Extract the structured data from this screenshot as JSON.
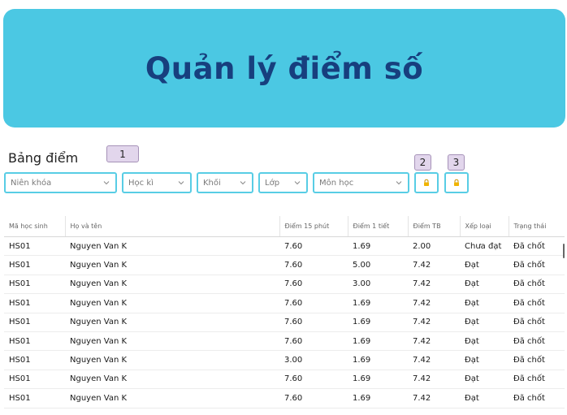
{
  "header": {
    "title": "Quản lý điểm số"
  },
  "section": {
    "title": "Bảng điểm"
  },
  "markers": [
    "1",
    "2",
    "3"
  ],
  "filters": {
    "nien_khoa": "Niên khóa",
    "hoc_ki": "Học kì",
    "khoi": "Khối",
    "lop": "Lớp",
    "mon_hoc": "Môn học"
  },
  "colors": {
    "banner": "#4bc8e3",
    "title": "#173f7e",
    "border": "#58cde5",
    "icon": "#f0b400"
  },
  "icons": {
    "dropdown": "chevron-down-icon",
    "action": "lock-icon"
  },
  "table": {
    "columns": [
      "Mã học sinh",
      "Họ và tên",
      "Điểm 15 phút",
      "Điểm 1 tiết",
      "Điểm TB",
      "Xếp loại",
      "Trạng thái"
    ],
    "rows": [
      [
        "HS01",
        "Nguyen Van K",
        "7.60",
        "1.69",
        "2.00",
        "Chưa đạt",
        "Đã chốt"
      ],
      [
        "HS01",
        "Nguyen Van K",
        "7.60",
        "5.00",
        "7.42",
        "Đạt",
        "Đã chốt"
      ],
      [
        "HS01",
        "Nguyen Van K",
        "7.60",
        "3.00",
        "7.42",
        "Đạt",
        "Đã chốt"
      ],
      [
        "HS01",
        "Nguyen Van K",
        "7.60",
        "1.69",
        "7.42",
        "Đạt",
        "Đã chốt"
      ],
      [
        "HS01",
        "Nguyen Van K",
        "7.60",
        "1.69",
        "7.42",
        "Đạt",
        "Đã chốt"
      ],
      [
        "HS01",
        "Nguyen Van K",
        "7.60",
        "1.69",
        "7.42",
        "Đạt",
        "Đã chốt"
      ],
      [
        "HS01",
        "Nguyen Van K",
        "3.00",
        "1.69",
        "7.42",
        "Đạt",
        "Đã chốt"
      ],
      [
        "HS01",
        "Nguyen Van K",
        "7.60",
        "1.69",
        "7.42",
        "Đạt",
        "Đã chốt"
      ],
      [
        "HS01",
        "Nguyen Van K",
        "7.60",
        "1.69",
        "7.42",
        "Đạt",
        "Đã chốt"
      ]
    ]
  }
}
